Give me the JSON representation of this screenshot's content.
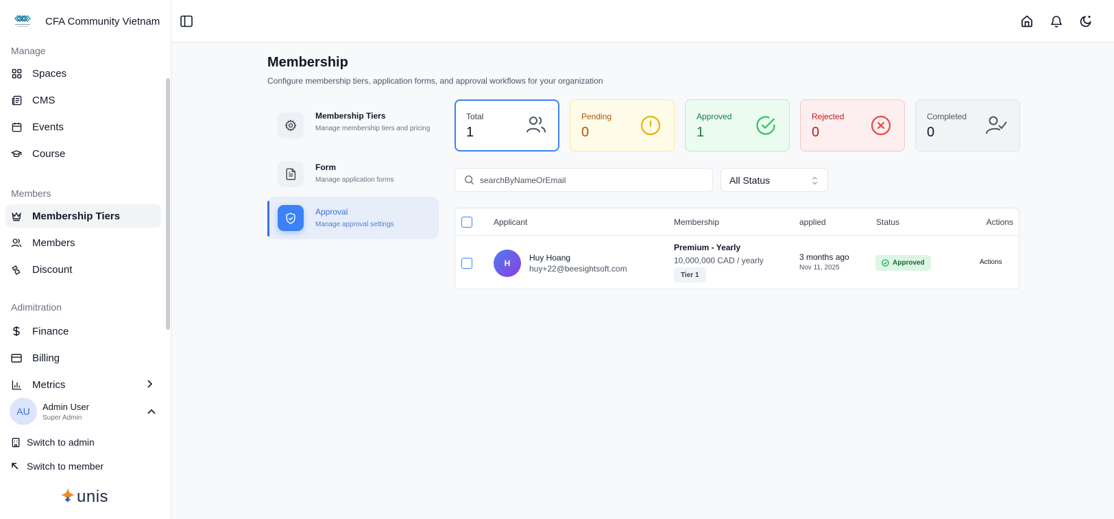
{
  "brand": {
    "name": "CFA Community Vietnam"
  },
  "sidebar": {
    "sections": [
      {
        "label": "Manage"
      },
      {
        "label": "Members"
      },
      {
        "label": "Adimitration"
      }
    ],
    "items": [
      {
        "label": "Spaces",
        "icon": "grid-icon"
      },
      {
        "label": "CMS",
        "icon": "newspaper-icon"
      },
      {
        "label": "Events",
        "icon": "calendar-icon"
      },
      {
        "label": "Course",
        "icon": "graduation-cap-icon"
      },
      {
        "label": "Membership Tiers",
        "icon": "crown-icon",
        "active": true
      },
      {
        "label": "Members",
        "icon": "users-icon"
      },
      {
        "label": "Discount",
        "icon": "tickets-icon"
      },
      {
        "label": "Finance",
        "icon": "dollar-icon"
      },
      {
        "label": "Billing",
        "icon": "credit-card-icon"
      },
      {
        "label": "Metrics",
        "icon": "chart-icon"
      }
    ],
    "user": {
      "initials": "AU",
      "name": "Admin User",
      "role": "Super Admin"
    },
    "switch_admin": "Switch to admin",
    "switch_member": "Switch to member",
    "footer_logo": "unis"
  },
  "page": {
    "title": "Membership",
    "subtitle": "Configure membership tiers, application forms, and approval workflows for your organization"
  },
  "menu": [
    {
      "title": "Membership Tiers",
      "desc": "Manage membership tiers and pricing",
      "icon": "gear-icon"
    },
    {
      "title": "Form",
      "desc": "Manage application forms",
      "icon": "file-text-icon"
    },
    {
      "title": "Approval",
      "desc": "Manage approval settings",
      "icon": "shield-check-icon",
      "active": true
    }
  ],
  "stats": {
    "total": {
      "label": "Total",
      "value": "1"
    },
    "pending": {
      "label": "Pending",
      "value": "0"
    },
    "approved": {
      "label": "Approved",
      "value": "1"
    },
    "rejected": {
      "label": "Rejected",
      "value": "0"
    },
    "completed": {
      "label": "Completed",
      "value": "0"
    }
  },
  "search": {
    "placeholder": "searchByNameOrEmail",
    "value": ""
  },
  "status_filter": {
    "selected": "All Status"
  },
  "table": {
    "headers": {
      "applicant": "Applicant",
      "membership": "Membership",
      "applied": "applied",
      "status": "Status",
      "actions": "Actions"
    },
    "rows": [
      {
        "initial": "H",
        "name": "Huy Hoang",
        "email": "huy+22@beesightsoft.com",
        "membership": "Premium - Yearly",
        "price": "10,000,000 CAD / yearly",
        "tier": "Tier 1",
        "applied_relative": "3 months ago",
        "applied_date": "Nov 11, 2025",
        "status": "Approved",
        "actions": "Actions"
      }
    ]
  },
  "colors": {
    "accent": "#3b82f6",
    "pending": "#b45309",
    "approved": "#15803d",
    "rejected": "#b91c1c"
  }
}
